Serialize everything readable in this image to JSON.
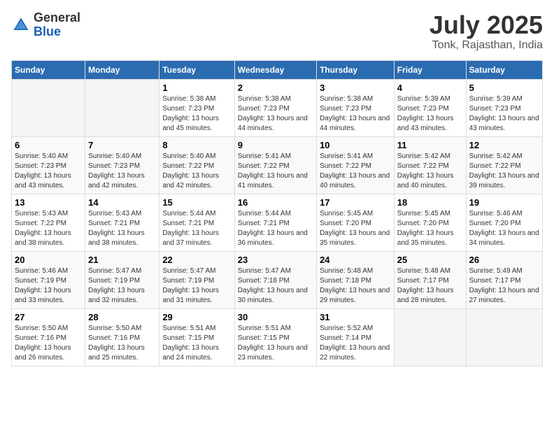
{
  "header": {
    "logo_general": "General",
    "logo_blue": "Blue",
    "title": "July 2025",
    "subtitle": "Tonk, Rajasthan, India"
  },
  "days_of_week": [
    "Sunday",
    "Monday",
    "Tuesday",
    "Wednesday",
    "Thursday",
    "Friday",
    "Saturday"
  ],
  "weeks": [
    [
      {
        "num": "",
        "sunrise": "",
        "sunset": "",
        "daylight": ""
      },
      {
        "num": "",
        "sunrise": "",
        "sunset": "",
        "daylight": ""
      },
      {
        "num": "1",
        "sunrise": "Sunrise: 5:38 AM",
        "sunset": "Sunset: 7:23 PM",
        "daylight": "Daylight: 13 hours and 45 minutes."
      },
      {
        "num": "2",
        "sunrise": "Sunrise: 5:38 AM",
        "sunset": "Sunset: 7:23 PM",
        "daylight": "Daylight: 13 hours and 44 minutes."
      },
      {
        "num": "3",
        "sunrise": "Sunrise: 5:38 AM",
        "sunset": "Sunset: 7:23 PM",
        "daylight": "Daylight: 13 hours and 44 minutes."
      },
      {
        "num": "4",
        "sunrise": "Sunrise: 5:39 AM",
        "sunset": "Sunset: 7:23 PM",
        "daylight": "Daylight: 13 hours and 43 minutes."
      },
      {
        "num": "5",
        "sunrise": "Sunrise: 5:39 AM",
        "sunset": "Sunset: 7:23 PM",
        "daylight": "Daylight: 13 hours and 43 minutes."
      }
    ],
    [
      {
        "num": "6",
        "sunrise": "Sunrise: 5:40 AM",
        "sunset": "Sunset: 7:23 PM",
        "daylight": "Daylight: 13 hours and 43 minutes."
      },
      {
        "num": "7",
        "sunrise": "Sunrise: 5:40 AM",
        "sunset": "Sunset: 7:23 PM",
        "daylight": "Daylight: 13 hours and 42 minutes."
      },
      {
        "num": "8",
        "sunrise": "Sunrise: 5:40 AM",
        "sunset": "Sunset: 7:22 PM",
        "daylight": "Daylight: 13 hours and 42 minutes."
      },
      {
        "num": "9",
        "sunrise": "Sunrise: 5:41 AM",
        "sunset": "Sunset: 7:22 PM",
        "daylight": "Daylight: 13 hours and 41 minutes."
      },
      {
        "num": "10",
        "sunrise": "Sunrise: 5:41 AM",
        "sunset": "Sunset: 7:22 PM",
        "daylight": "Daylight: 13 hours and 40 minutes."
      },
      {
        "num": "11",
        "sunrise": "Sunrise: 5:42 AM",
        "sunset": "Sunset: 7:22 PM",
        "daylight": "Daylight: 13 hours and 40 minutes."
      },
      {
        "num": "12",
        "sunrise": "Sunrise: 5:42 AM",
        "sunset": "Sunset: 7:22 PM",
        "daylight": "Daylight: 13 hours and 39 minutes."
      }
    ],
    [
      {
        "num": "13",
        "sunrise": "Sunrise: 5:43 AM",
        "sunset": "Sunset: 7:22 PM",
        "daylight": "Daylight: 13 hours and 38 minutes."
      },
      {
        "num": "14",
        "sunrise": "Sunrise: 5:43 AM",
        "sunset": "Sunset: 7:21 PM",
        "daylight": "Daylight: 13 hours and 38 minutes."
      },
      {
        "num": "15",
        "sunrise": "Sunrise: 5:44 AM",
        "sunset": "Sunset: 7:21 PM",
        "daylight": "Daylight: 13 hours and 37 minutes."
      },
      {
        "num": "16",
        "sunrise": "Sunrise: 5:44 AM",
        "sunset": "Sunset: 7:21 PM",
        "daylight": "Daylight: 13 hours and 36 minutes."
      },
      {
        "num": "17",
        "sunrise": "Sunrise: 5:45 AM",
        "sunset": "Sunset: 7:20 PM",
        "daylight": "Daylight: 13 hours and 35 minutes."
      },
      {
        "num": "18",
        "sunrise": "Sunrise: 5:45 AM",
        "sunset": "Sunset: 7:20 PM",
        "daylight": "Daylight: 13 hours and 35 minutes."
      },
      {
        "num": "19",
        "sunrise": "Sunrise: 5:46 AM",
        "sunset": "Sunset: 7:20 PM",
        "daylight": "Daylight: 13 hours and 34 minutes."
      }
    ],
    [
      {
        "num": "20",
        "sunrise": "Sunrise: 5:46 AM",
        "sunset": "Sunset: 7:19 PM",
        "daylight": "Daylight: 13 hours and 33 minutes."
      },
      {
        "num": "21",
        "sunrise": "Sunrise: 5:47 AM",
        "sunset": "Sunset: 7:19 PM",
        "daylight": "Daylight: 13 hours and 32 minutes."
      },
      {
        "num": "22",
        "sunrise": "Sunrise: 5:47 AM",
        "sunset": "Sunset: 7:19 PM",
        "daylight": "Daylight: 13 hours and 31 minutes."
      },
      {
        "num": "23",
        "sunrise": "Sunrise: 5:47 AM",
        "sunset": "Sunset: 7:18 PM",
        "daylight": "Daylight: 13 hours and 30 minutes."
      },
      {
        "num": "24",
        "sunrise": "Sunrise: 5:48 AM",
        "sunset": "Sunset: 7:18 PM",
        "daylight": "Daylight: 13 hours and 29 minutes."
      },
      {
        "num": "25",
        "sunrise": "Sunrise: 5:48 AM",
        "sunset": "Sunset: 7:17 PM",
        "daylight": "Daylight: 13 hours and 28 minutes."
      },
      {
        "num": "26",
        "sunrise": "Sunrise: 5:49 AM",
        "sunset": "Sunset: 7:17 PM",
        "daylight": "Daylight: 13 hours and 27 minutes."
      }
    ],
    [
      {
        "num": "27",
        "sunrise": "Sunrise: 5:50 AM",
        "sunset": "Sunset: 7:16 PM",
        "daylight": "Daylight: 13 hours and 26 minutes."
      },
      {
        "num": "28",
        "sunrise": "Sunrise: 5:50 AM",
        "sunset": "Sunset: 7:16 PM",
        "daylight": "Daylight: 13 hours and 25 minutes."
      },
      {
        "num": "29",
        "sunrise": "Sunrise: 5:51 AM",
        "sunset": "Sunset: 7:15 PM",
        "daylight": "Daylight: 13 hours and 24 minutes."
      },
      {
        "num": "30",
        "sunrise": "Sunrise: 5:51 AM",
        "sunset": "Sunset: 7:15 PM",
        "daylight": "Daylight: 13 hours and 23 minutes."
      },
      {
        "num": "31",
        "sunrise": "Sunrise: 5:52 AM",
        "sunset": "Sunset: 7:14 PM",
        "daylight": "Daylight: 13 hours and 22 minutes."
      },
      {
        "num": "",
        "sunrise": "",
        "sunset": "",
        "daylight": ""
      },
      {
        "num": "",
        "sunrise": "",
        "sunset": "",
        "daylight": ""
      }
    ]
  ]
}
